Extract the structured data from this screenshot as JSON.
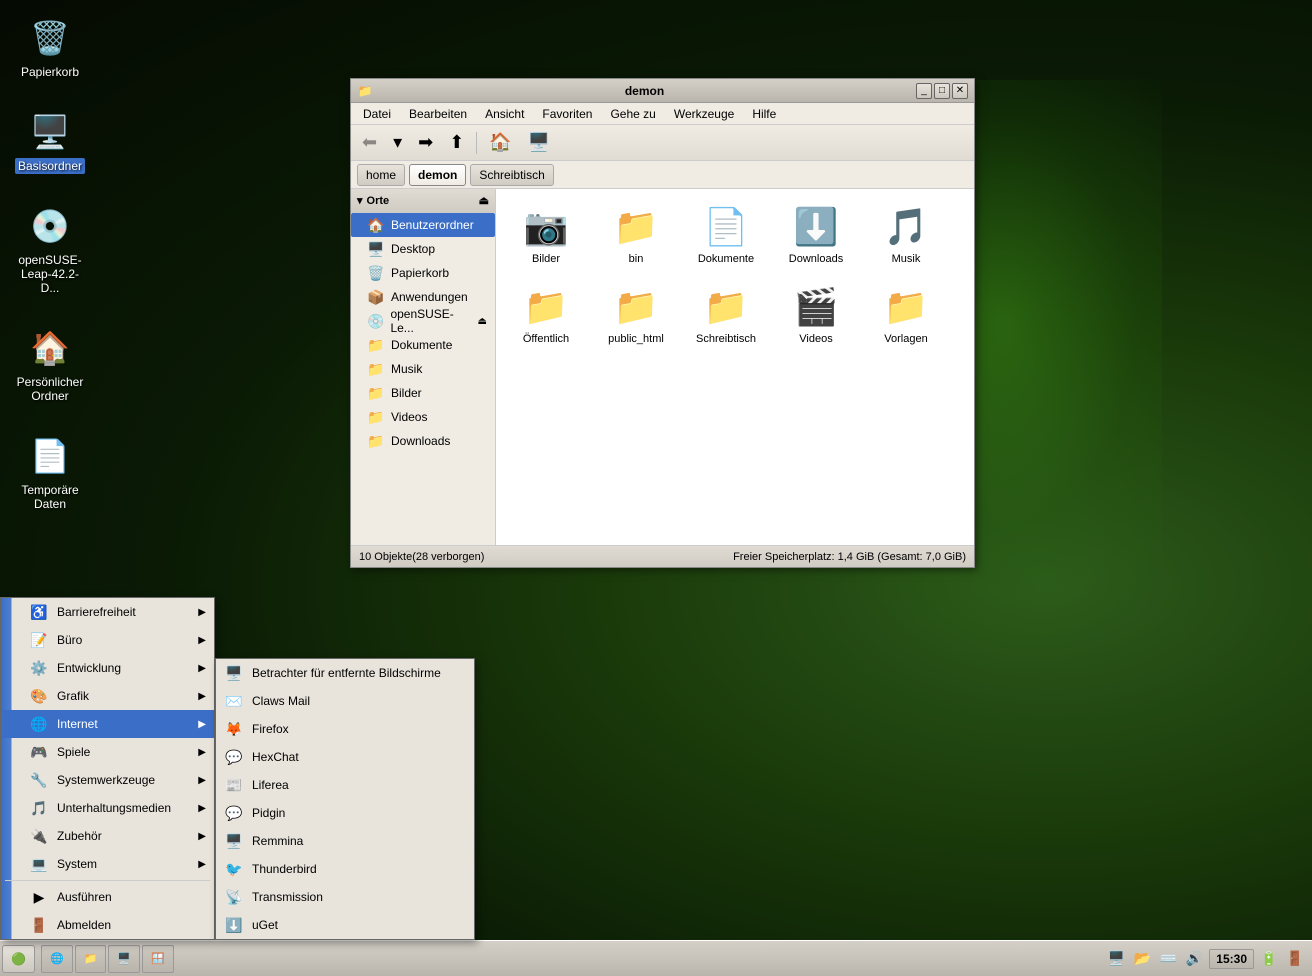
{
  "desktop": {
    "background": "dark green with lightbulb glow"
  },
  "desktop_icons": [
    {
      "id": "papierkorb",
      "label": "Papierkorb",
      "icon": "🗑️",
      "selected": false
    },
    {
      "id": "basisordner",
      "label": "Basisordner",
      "icon": "🖥️",
      "selected": true
    },
    {
      "id": "opensuse",
      "label": "openSUSE-Leap-42.2-D...",
      "icon": "💿",
      "selected": false
    },
    {
      "id": "persoenlicher",
      "label": "Persönlicher Ordner",
      "icon": "🏠",
      "selected": false
    },
    {
      "id": "temporaere",
      "label": "Temporäre Daten",
      "icon": "📄",
      "selected": false
    }
  ],
  "file_manager": {
    "title": "demon",
    "titlebar_icon": "📁",
    "menu": [
      "Datei",
      "Bearbeiten",
      "Ansicht",
      "Favoriten",
      "Gehe zu",
      "Werkzeuge",
      "Hilfe"
    ],
    "location_buttons": [
      "home",
      "demon",
      "Schreibtisch"
    ],
    "sidebar": {
      "section_label": "Orte",
      "items": [
        {
          "id": "benutzerordner",
          "label": "Benutzerordner",
          "icon": "🏠",
          "active": true
        },
        {
          "id": "desktop",
          "label": "Desktop",
          "icon": "🖥️",
          "active": false
        },
        {
          "id": "papierkorb",
          "label": "Papierkorb",
          "icon": "🗑️",
          "active": false
        },
        {
          "id": "anwendungen",
          "label": "Anwendungen",
          "icon": "📦",
          "active": false
        },
        {
          "id": "opensuse",
          "label": "openSUSE-Le...",
          "icon": "💿",
          "active": false
        },
        {
          "id": "dokumente",
          "label": "Dokumente",
          "icon": "📁",
          "active": false
        },
        {
          "id": "musik",
          "label": "Musik",
          "icon": "📁",
          "active": false
        },
        {
          "id": "bilder",
          "label": "Bilder",
          "icon": "📁",
          "active": false
        },
        {
          "id": "videos",
          "label": "Videos",
          "icon": "📁",
          "active": false
        },
        {
          "id": "downloads",
          "label": "Downloads",
          "icon": "📁",
          "active": false
        }
      ]
    },
    "files": [
      {
        "id": "bilder",
        "name": "Bilder",
        "icon": "📸"
      },
      {
        "id": "bin",
        "name": "bin",
        "icon": "📁"
      },
      {
        "id": "dokumente",
        "name": "Dokumente",
        "icon": "📄"
      },
      {
        "id": "downloads",
        "name": "Downloads",
        "icon": "⬇️"
      },
      {
        "id": "musik",
        "name": "Musik",
        "icon": "🎵"
      },
      {
        "id": "oeffentlich",
        "name": "Öffentlich",
        "icon": "📁"
      },
      {
        "id": "public_html",
        "name": "public_html",
        "icon": "📁"
      },
      {
        "id": "schreibtisch",
        "name": "Schreibtisch",
        "icon": "📁"
      },
      {
        "id": "videos",
        "name": "Videos",
        "icon": "🎬"
      },
      {
        "id": "vorlagen",
        "name": "Vorlagen",
        "icon": "📁"
      }
    ],
    "statusbar": {
      "left": "10 Objekte(28 verborgen)",
      "right": "Freier Speicherplatz: 1,4 GiB (Gesamt: 7,0 GiB)"
    }
  },
  "app_menu": {
    "items": [
      {
        "id": "barrierefreiheit",
        "label": "Barrierefreiheit",
        "has_arrow": true
      },
      {
        "id": "buero",
        "label": "Büro",
        "has_arrow": true
      },
      {
        "id": "entwicklung",
        "label": "Entwicklung",
        "has_arrow": true
      },
      {
        "id": "grafik",
        "label": "Grafik",
        "has_arrow": true
      },
      {
        "id": "internet",
        "label": "Internet",
        "has_arrow": true,
        "active": true
      },
      {
        "id": "spiele",
        "label": "Spiele",
        "has_arrow": true
      },
      {
        "id": "systemwerkzeuge",
        "label": "Systemwerkzeuge",
        "has_arrow": true
      },
      {
        "id": "unterhaltungsmedien",
        "label": "Unterhaltungsmedien",
        "has_arrow": true
      },
      {
        "id": "zubehoer",
        "label": "Zubehör",
        "has_arrow": true
      },
      {
        "id": "system",
        "label": "System",
        "has_arrow": true
      }
    ],
    "bottom_items": [
      {
        "id": "ausfuehren",
        "label": "Ausführen",
        "has_arrow": false
      },
      {
        "id": "abmelden",
        "label": "Abmelden",
        "has_arrow": false
      }
    ]
  },
  "internet_submenu": {
    "items": [
      {
        "id": "betrachter",
        "label": "Betrachter für entfernte Bildschirme"
      },
      {
        "id": "claws",
        "label": "Claws Mail"
      },
      {
        "id": "firefox",
        "label": "Firefox"
      },
      {
        "id": "hexchat",
        "label": "HexChat"
      },
      {
        "id": "liferea",
        "label": "Liferea"
      },
      {
        "id": "pidgin",
        "label": "Pidgin"
      },
      {
        "id": "remmina",
        "label": "Remmina"
      },
      {
        "id": "thunderbird",
        "label": "Thunderbird"
      },
      {
        "id": "transmission",
        "label": "Transmission"
      },
      {
        "id": "uget",
        "label": "uGet"
      }
    ]
  },
  "taskbar": {
    "start_icon": "🟢",
    "clock": "15:30",
    "apps": [
      {
        "id": "browser",
        "label": ""
      },
      {
        "id": "folder",
        "label": ""
      },
      {
        "id": "desktop",
        "label": ""
      },
      {
        "id": "window",
        "label": ""
      }
    ]
  }
}
